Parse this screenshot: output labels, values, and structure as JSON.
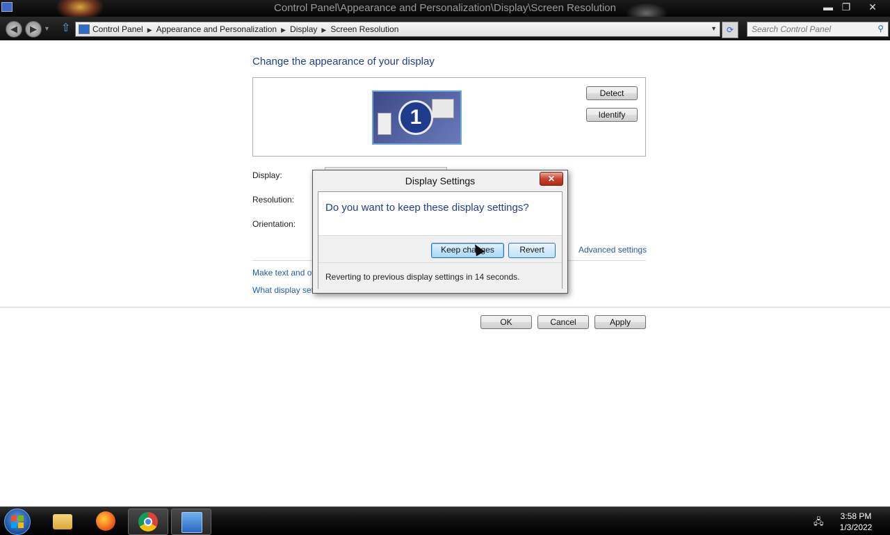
{
  "window": {
    "title": "Control Panel\\Appearance and Personalization\\Display\\Screen Resolution",
    "min_glyph": "▬",
    "max_glyph": "❐",
    "close_glyph": "✕"
  },
  "nav": {
    "back_glyph": "◀",
    "forward_glyph": "▶",
    "dropdown_glyph": "▼",
    "up_glyph": "⇧",
    "breadcrumbs": [
      "Control Panel",
      "Appearance and Personalization",
      "Display",
      "Screen Resolution"
    ],
    "crumb_separator": "▶",
    "address_dropdown_glyph": "▼",
    "refresh_glyph": "⟳",
    "search_placeholder": "Search Control Panel",
    "search_glyph": "⚲"
  },
  "main": {
    "heading": "Change the appearance of your display",
    "monitor_number": "1",
    "detect_label": "Detect",
    "identify_label": "Identify",
    "display_label": "Display:",
    "resolution_label": "Resolution:",
    "orientation_label": "Orientation:",
    "advanced_link": "Advanced settings",
    "text_link": "Make text and ot",
    "what_link": "What display setti",
    "ok_label": "OK",
    "cancel_label": "Cancel",
    "apply_label": "Apply"
  },
  "dialog": {
    "title": "Display Settings",
    "close_glyph": "✕",
    "question": "Do you want to keep these display settings?",
    "keep_label": "Keep changes",
    "revert_label": "Revert",
    "status": "Reverting to previous display settings in 14 seconds."
  },
  "taskbar": {
    "network_glyph": "🖧",
    "time": "3:58 PM",
    "date": "1/3/2022"
  },
  "icons": [
    "app-icon",
    "back-icon",
    "forward-icon",
    "up-icon",
    "control-panel-icon",
    "refresh-icon",
    "search-icon",
    "close-icon",
    "windows-logo-icon",
    "folder-icon",
    "firefox-icon",
    "chrome-icon",
    "network-icon"
  ]
}
